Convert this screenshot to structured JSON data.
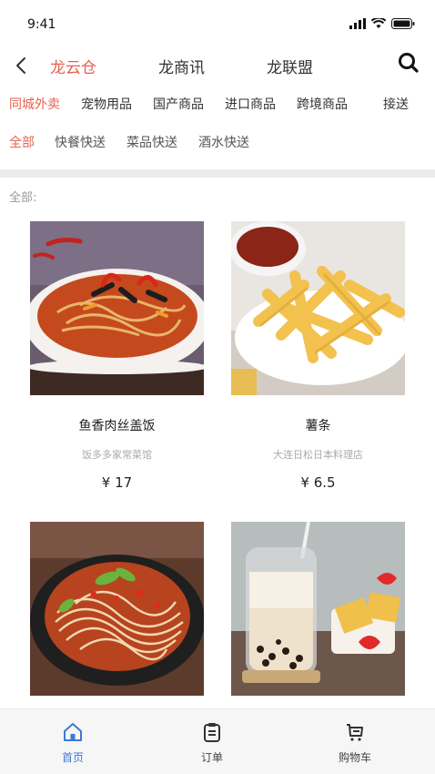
{
  "status_bar": {
    "time": "9:41",
    "icons": [
      "signal-icon",
      "wifi-icon",
      "battery-icon"
    ]
  },
  "nav": {
    "back_icon": "chevron-left-icon",
    "tabs": [
      {
        "label": "龙云仓",
        "active": true
      },
      {
        "label": "龙商讯",
        "active": false
      },
      {
        "label": "龙联盟",
        "active": false
      }
    ],
    "search_icon": "search-icon"
  },
  "categories": [
    {
      "label": "同城外卖",
      "active": true
    },
    {
      "label": "宠物用品",
      "active": false
    },
    {
      "label": "国产商品",
      "active": false
    },
    {
      "label": "进口商品",
      "active": false
    },
    {
      "label": "跨境商品",
      "active": false
    },
    {
      "label": "接送",
      "active": false
    }
  ],
  "subcategories": [
    {
      "label": "全部",
      "active": true
    },
    {
      "label": "快餐快送",
      "active": false
    },
    {
      "label": "菜品快送",
      "active": false
    },
    {
      "label": "酒水快送",
      "active": false
    }
  ],
  "section_label": "全部:",
  "products": [
    {
      "name": "鱼香肉丝盖饭",
      "shop": "饭多多家常菜馆",
      "price": "¥ 17",
      "image": "shredded-pork-dish-photo"
    },
    {
      "name": "薯条",
      "shop": "大连日松日本料理店",
      "price": "¥ 6.5",
      "image": "french-fries-photo"
    },
    {
      "name": "",
      "shop": "",
      "price": "",
      "image": "noodles-bowl-photo"
    },
    {
      "name": "",
      "shop": "",
      "price": "",
      "image": "bubble-tea-photo"
    }
  ],
  "bottom_nav": [
    {
      "label": "首页",
      "icon": "home-icon",
      "active": true
    },
    {
      "label": "订单",
      "icon": "clipboard-icon",
      "active": false
    },
    {
      "label": "购物车",
      "icon": "cart-icon",
      "active": false
    }
  ],
  "colors": {
    "accent": "#e8604f",
    "tab_active": "#3a7bd5",
    "divider": "#ececec"
  }
}
